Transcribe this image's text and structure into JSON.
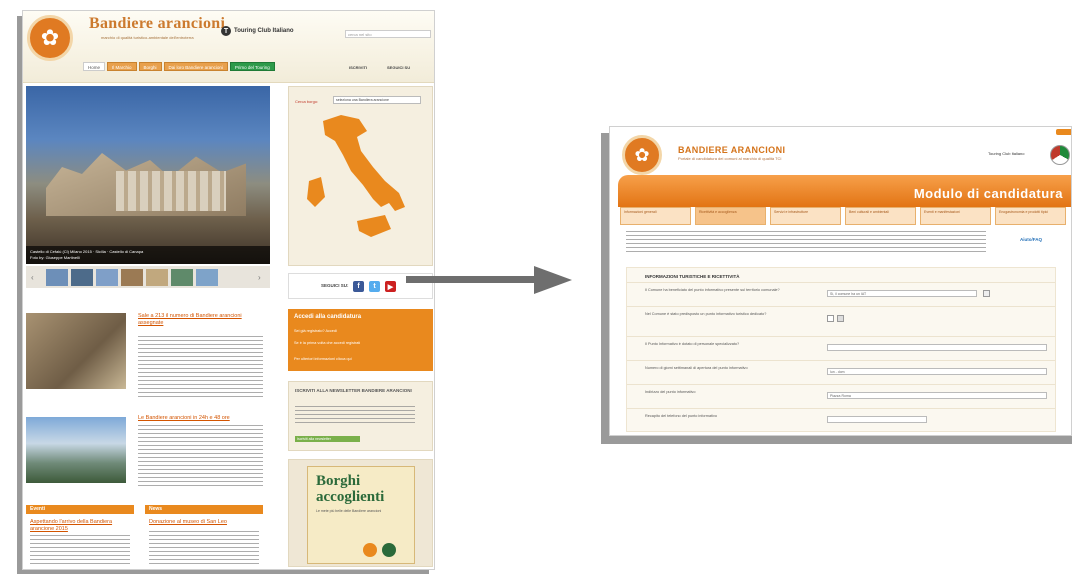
{
  "left_page": {
    "site_title": "Bandiere arancioni",
    "site_subtitle": "marchio di qualità turistico-ambientale dell'entroterra",
    "partner": "Touring Club Italiano",
    "search_placeholder": "cerca nel sito",
    "nav": [
      "Home",
      "Il Marchio",
      "Borghi",
      "Dai loro Bandiere arancioni",
      "Primo del Touring"
    ],
    "social_links": [
      "ISCRIVITI",
      "SEGUICI SU"
    ],
    "hero_caption": "Castello di Cefalù (Cl) Milano 2015 · Sicilia · Castello di Canapa",
    "hero_credit": "Foto by: Giuseppe Martinelli",
    "map_label": "Cerca borgo:",
    "map_select": "seleziona una Bandiera arancione",
    "follow_label": "SEGUICI SU:",
    "articles": [
      {
        "title": "Sale a 213 il numero di Bandiere arancioni assegnate"
      },
      {
        "title": "Le Bandiere arancioni in 24h e 48 ore"
      }
    ],
    "side_orange": {
      "title": "Accedi alla candidatura",
      "lines": [
        "Sei già registrato? Accedi",
        "Se è la prima volta che accedi registrati",
        "Per ulteriori informazioni clicca qui"
      ]
    },
    "side_cream": {
      "title": "ISCRIVITI ALLA NEWSLETTER BANDIERE ARANCIONI",
      "button": "Iscriviti alla newsletter"
    },
    "book": {
      "title_line1": "Borghi",
      "title_line2": "accoglienti",
      "subtitle": "Le mete più belle delle Bandiere arancioni"
    },
    "boxes": [
      {
        "heading": "Eventi",
        "link": "Aspettando l'arrivo della Bandiera arancione 2015"
      },
      {
        "heading": "News",
        "link": "Donazione al museo di San Leo"
      }
    ]
  },
  "right_page": {
    "title": "BANDIERE ARANCIONI",
    "subtitle": "Portale di candidatura dei comuni al marchio di qualità TCI",
    "partner": "Touring Club Italiano",
    "banner": "Modulo di candidatura",
    "tabs": [
      "Informazioni generali",
      "Ricettività e accoglienza",
      "Servizi e infrastrutture",
      "Beni culturali e ambientali",
      "Eventi e manifestazioni",
      "Enogastronomia e prodotti tipici"
    ],
    "help_link": "Aiuto/FAQ",
    "section_title": "INFORMAZIONI TURISTICHE E RICETTIVITÀ",
    "rows": [
      {
        "label": "Il Comune ha beneficiato del punto informativo presente sul territorio comunale?",
        "value": "Sì, il comune ha un IAT"
      },
      {
        "label": "Nel Comune è stato predisposto un punto informativo turistico dedicato?",
        "value": ""
      },
      {
        "label": "Il Punto Informativo è dotato di personale specializzato?",
        "value": ""
      },
      {
        "label": "Numero di giorni settimanali di apertura del punto informativo",
        "value": "lun - dom"
      },
      {
        "label": "Indirizzo del punto informativo",
        "value": "Piazza Roma"
      },
      {
        "label": "Recapito del telefono del punto informativo",
        "value": ""
      }
    ]
  }
}
